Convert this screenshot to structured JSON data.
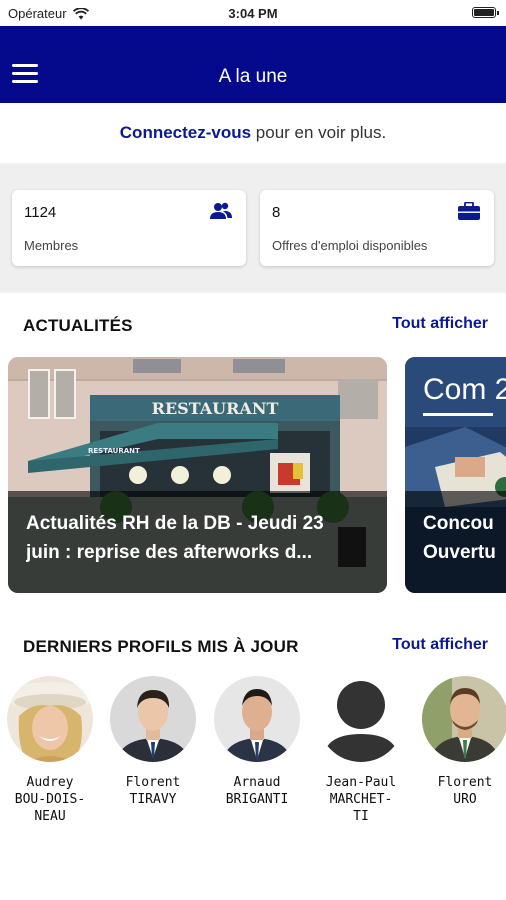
{
  "status_bar": {
    "carrier": "Opérateur",
    "time": "3:04 PM"
  },
  "nav": {
    "title": "A la une"
  },
  "login": {
    "link": "Connectez-vous",
    "rest": " pour en voir plus."
  },
  "stats": [
    {
      "value": "1124",
      "label": "Membres",
      "icon": "members-icon"
    },
    {
      "value": "8",
      "label": "Offres d'emploi disponibles",
      "icon": "briefcase-icon"
    }
  ],
  "news": {
    "title": "ACTUALITÉS",
    "see_all": "Tout afficher",
    "items": [
      {
        "line1": "Actualités RH de la DB - Jeudi 23",
        "line2": "juin : reprise des afterworks d...",
        "sign": "RESTAURANT",
        "awning": "RESTAURANT"
      },
      {
        "line1": "Concou",
        "line2": "Ouvertu",
        "image_text": "Com 2"
      }
    ]
  },
  "profiles": {
    "title": "DERNIERS PROFILS MIS À JOUR",
    "see_all": "Tout afficher",
    "items": [
      {
        "first": "Audrey",
        "last": [
          "BOU-DOIS-",
          "NEAU"
        ]
      },
      {
        "first": "Florent",
        "last": [
          "TIRAVY"
        ]
      },
      {
        "first": "Arnaud",
        "last": [
          "BRIGANTI"
        ]
      },
      {
        "first": "Jean-Paul",
        "last": [
          "MARCHET-",
          "TI"
        ]
      },
      {
        "first": "Florent",
        "last": [
          "URO"
        ]
      }
    ]
  },
  "colors": {
    "primary": "#050a8c",
    "link": "#0c1a8f",
    "background_gray": "#efefef"
  }
}
